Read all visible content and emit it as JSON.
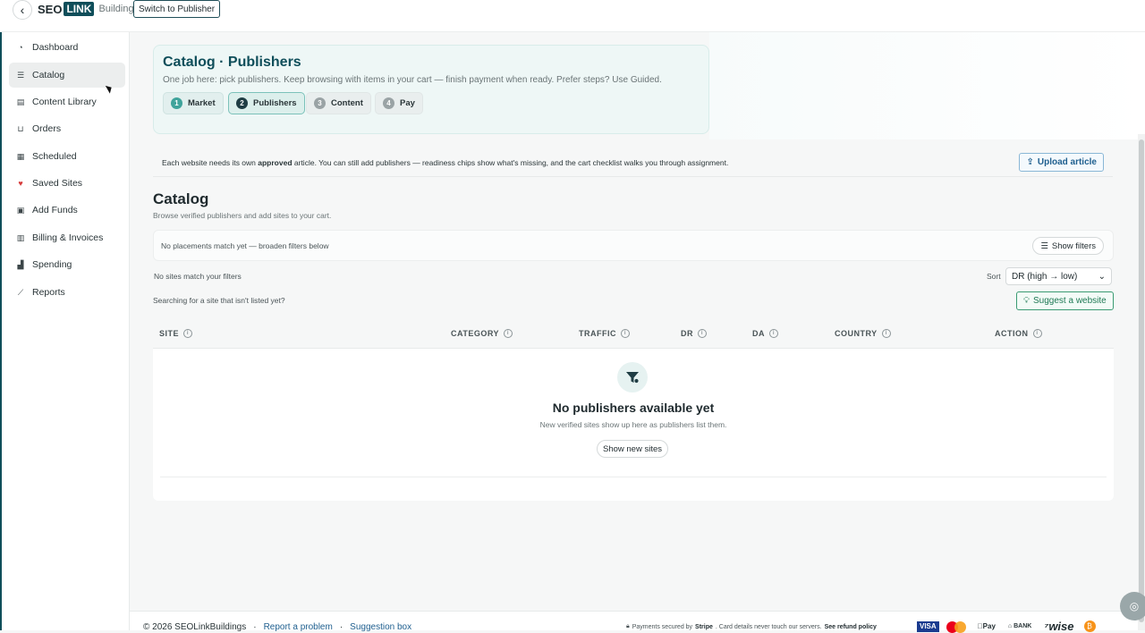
{
  "topbar": {
    "logo_seo": "SEO",
    "logo_link": "LINK",
    "logo_buildings": "Buildings",
    "switch_label": "Switch to Publisher"
  },
  "sidebar": {
    "items": [
      {
        "label": "Dashboard",
        "icon": "gauge-icon"
      },
      {
        "label": "Catalog",
        "icon": "list-icon",
        "active": true
      },
      {
        "label": "Content Library",
        "icon": "document-icon"
      },
      {
        "label": "Orders",
        "icon": "cart-icon"
      },
      {
        "label": "Scheduled",
        "icon": "calendar-icon"
      },
      {
        "label": "Saved Sites",
        "icon": "heart-icon"
      },
      {
        "label": "Add Funds",
        "icon": "wallet-icon"
      },
      {
        "label": "Billing & Invoices",
        "icon": "receipt-icon"
      },
      {
        "label": "Spending",
        "icon": "bar-chart-icon"
      },
      {
        "label": "Reports",
        "icon": "line-chart-icon"
      }
    ]
  },
  "hero": {
    "title": "Catalog · Publishers",
    "subtitle": "One job here: pick publishers. Keep browsing with items in your cart — finish payment when ready. Prefer steps? Use Guided.",
    "steps": [
      {
        "num": "1",
        "label": "Market"
      },
      {
        "num": "2",
        "label": "Publishers"
      },
      {
        "num": "3",
        "label": "Content"
      },
      {
        "num": "4",
        "label": "Pay"
      }
    ]
  },
  "notice": {
    "pre": "Each website needs its own ",
    "bold": "approved",
    "post": " article. You can still add publishers — readiness chips show what's missing, and the cart checklist walks you through assignment.",
    "upload_label": "Upload article"
  },
  "catalog": {
    "title": "Catalog",
    "subtitle": "Browse verified publishers and add sites to your cart.",
    "filter_text": "No placements match yet — broaden filters below",
    "show_filters": "Show filters",
    "no_sites": "No sites match your filters",
    "sort_label": "Sort",
    "sort_value": "DR (high → low)",
    "searching": "Searching for a site that isn't listed yet?",
    "suggest_label": "Suggest a website"
  },
  "table": {
    "columns": [
      "SITE",
      "CATEGORY",
      "TRAFFIC",
      "DR",
      "DA",
      "COUNTRY",
      "ACTION"
    ]
  },
  "empty": {
    "title": "No publishers available yet",
    "subtitle": "New verified sites show up here as publishers list them.",
    "button": "Show new sites"
  },
  "footer": {
    "copyright": "© 2026 SEOLinkBuildings",
    "sep": "·",
    "report": "Report a problem",
    "suggestion": "Suggestion box",
    "secure_pre": "Payments secured by",
    "secure_brand": "Stripe",
    "secure_post": ". Card details never touch our servers.",
    "refund": "See refund policy",
    "pay_visa": "VISA",
    "pay_apple": "Pay",
    "pay_bank": "BANK",
    "pay_wise": "wise"
  },
  "colors": {
    "brand": "#0f4e5a",
    "accent_teal": "#3fa39b",
    "upload_blue": "#1f5f8f",
    "suggest_green": "#1f7a55",
    "heart_red": "#d63b3b"
  }
}
